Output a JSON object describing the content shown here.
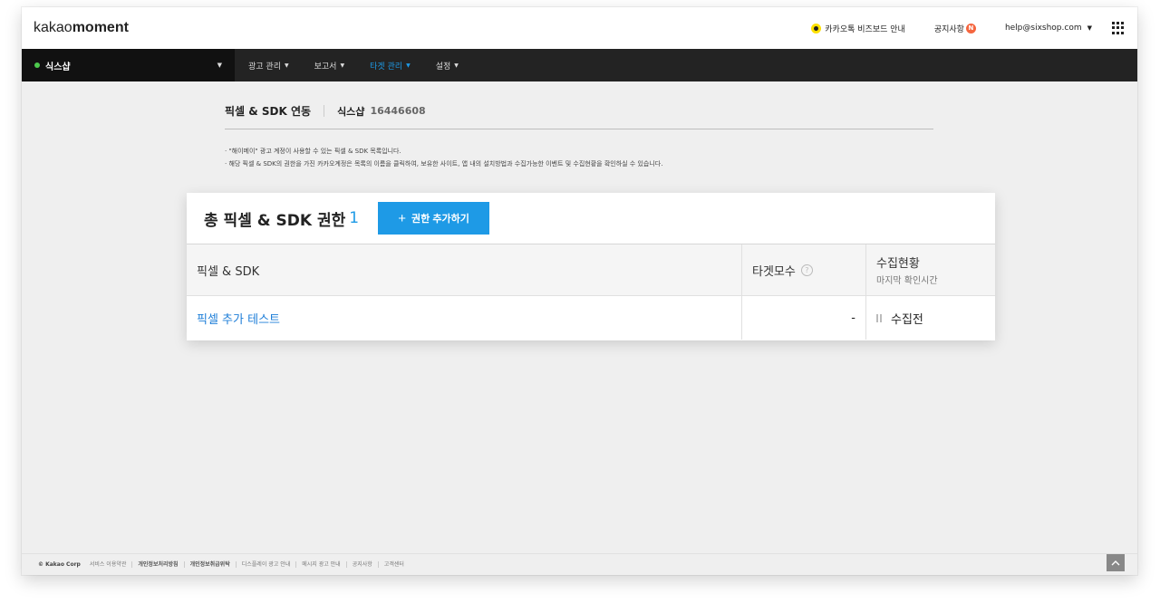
{
  "header": {
    "logo_light": "kakao",
    "logo_bold": "moment",
    "kakaotalk_link": "카카오톡 비즈보드 안내",
    "notice_link": "공지사항",
    "notice_badge": "N",
    "account_email": "help@sixshop.com"
  },
  "nav": {
    "ad_account": "식스샵",
    "items": [
      {
        "label": "광고 관리",
        "active": false
      },
      {
        "label": "보고서",
        "active": false
      },
      {
        "label": "타겟 관리",
        "active": true
      },
      {
        "label": "설정",
        "active": false
      }
    ]
  },
  "page": {
    "title": "픽셀 & SDK 연동",
    "account_name": "식스샵",
    "account_id": "16446608",
    "notes": [
      "· \"해이메이\" 광고 계정이 사용할 수 있는 픽셀 & SDK 목록입니다.",
      "· 해당 픽셀 & SDK의 권한을 가진 카카오계정은 목록의 이름을 클릭하여, 보유한 사이트, 앱 내의 설치방법과 수집가능한 이벤트 및 수집현황을 확인하실 수 있습니다."
    ]
  },
  "card": {
    "title": "총 픽셀 & SDK 권한",
    "count": "1",
    "add_button": "권한 추가하기",
    "add_button_icon": "+",
    "columns": {
      "name": "픽셀 & SDK",
      "target": "타겟모수",
      "status": "수집현황",
      "status_sub": "마지막 확인시간"
    },
    "rows": [
      {
        "name": "픽셀 추가 테스트",
        "target": "-",
        "status": "수집전"
      }
    ]
  },
  "footer": {
    "copyright": "© Kakao Corp",
    "links": [
      {
        "label": "서비스 이용약관",
        "bold": false
      },
      {
        "label": "개인정보처리방침",
        "bold": true
      },
      {
        "label": "개인정보취급위탁",
        "bold": true
      },
      {
        "label": "디스플레이 광고 안내",
        "bold": false
      },
      {
        "label": "메시지 광고 안내",
        "bold": false
      },
      {
        "label": "공지사항",
        "bold": false
      },
      {
        "label": "고객센터",
        "bold": false
      }
    ]
  }
}
